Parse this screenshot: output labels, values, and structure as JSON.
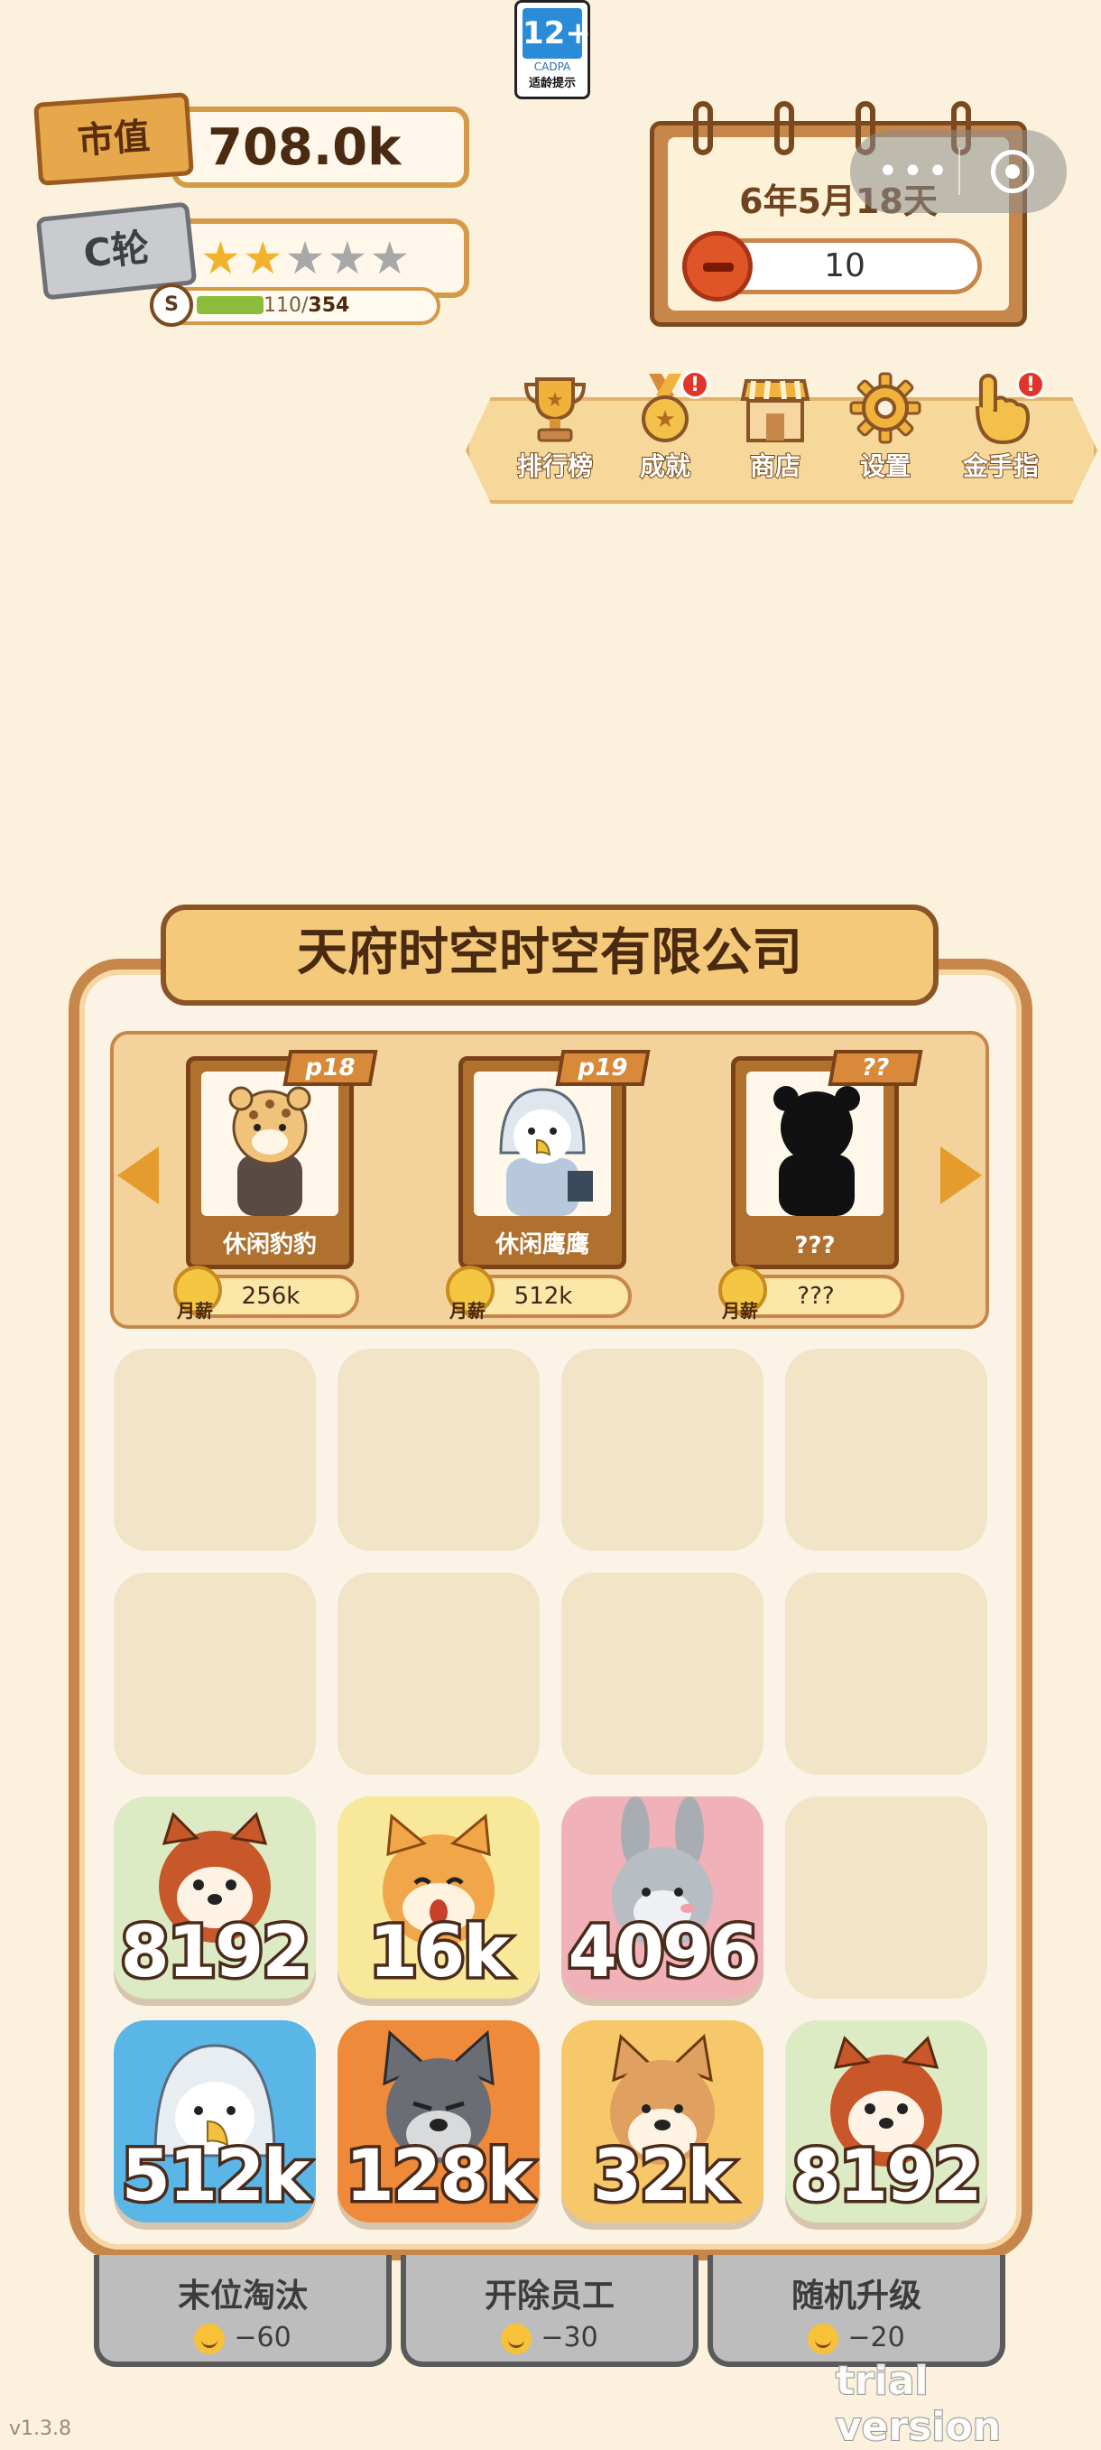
{
  "age_badge": {
    "rating": "12+",
    "org": "CADPA",
    "tip": "适龄提示"
  },
  "market_value": {
    "label": "市值",
    "value": "708.0k"
  },
  "round": {
    "label": "C轮",
    "stars_total": 5,
    "stars_filled": 2,
    "progress_badge": "S",
    "progress_current": "110/",
    "progress_max": "354"
  },
  "calendar": {
    "date": "6年5月18天",
    "anger_value": "10"
  },
  "menu": [
    {
      "label": "排行榜",
      "icon": "trophy-icon",
      "alert": false
    },
    {
      "label": "成就",
      "icon": "medal-icon",
      "alert": true
    },
    {
      "label": "商店",
      "icon": "shop-icon",
      "alert": false
    },
    {
      "label": "设置",
      "icon": "gear-icon",
      "alert": false
    },
    {
      "label": "金手指",
      "icon": "pointing-hand-icon",
      "alert": true
    }
  ],
  "alert_mark": "!",
  "company": {
    "name": "天府时空时空有限公司"
  },
  "roster": [
    {
      "tag": "p18",
      "name": "休闲豹豹",
      "salary": "256k",
      "salary_label": "月薪"
    },
    {
      "tag": "p19",
      "name": "休闲鹰鹰",
      "salary": "512k",
      "salary_label": "月薪"
    },
    {
      "tag": "??",
      "name": "???",
      "salary": "???",
      "salary_label": "月薪"
    }
  ],
  "grid": [
    [
      "",
      "",
      "",
      ""
    ],
    [
      "",
      "",
      "",
      ""
    ],
    [
      "8192",
      "16k",
      "4096",
      ""
    ],
    [
      "512k",
      "128k",
      "32k",
      "8192"
    ]
  ],
  "actions": [
    {
      "label": "末位淘汰",
      "cost": "−60"
    },
    {
      "label": "开除员工",
      "cost": "−30"
    },
    {
      "label": "随机升级",
      "cost": "−20"
    }
  ],
  "watermark": "trial version",
  "version": "v1.3.8"
}
